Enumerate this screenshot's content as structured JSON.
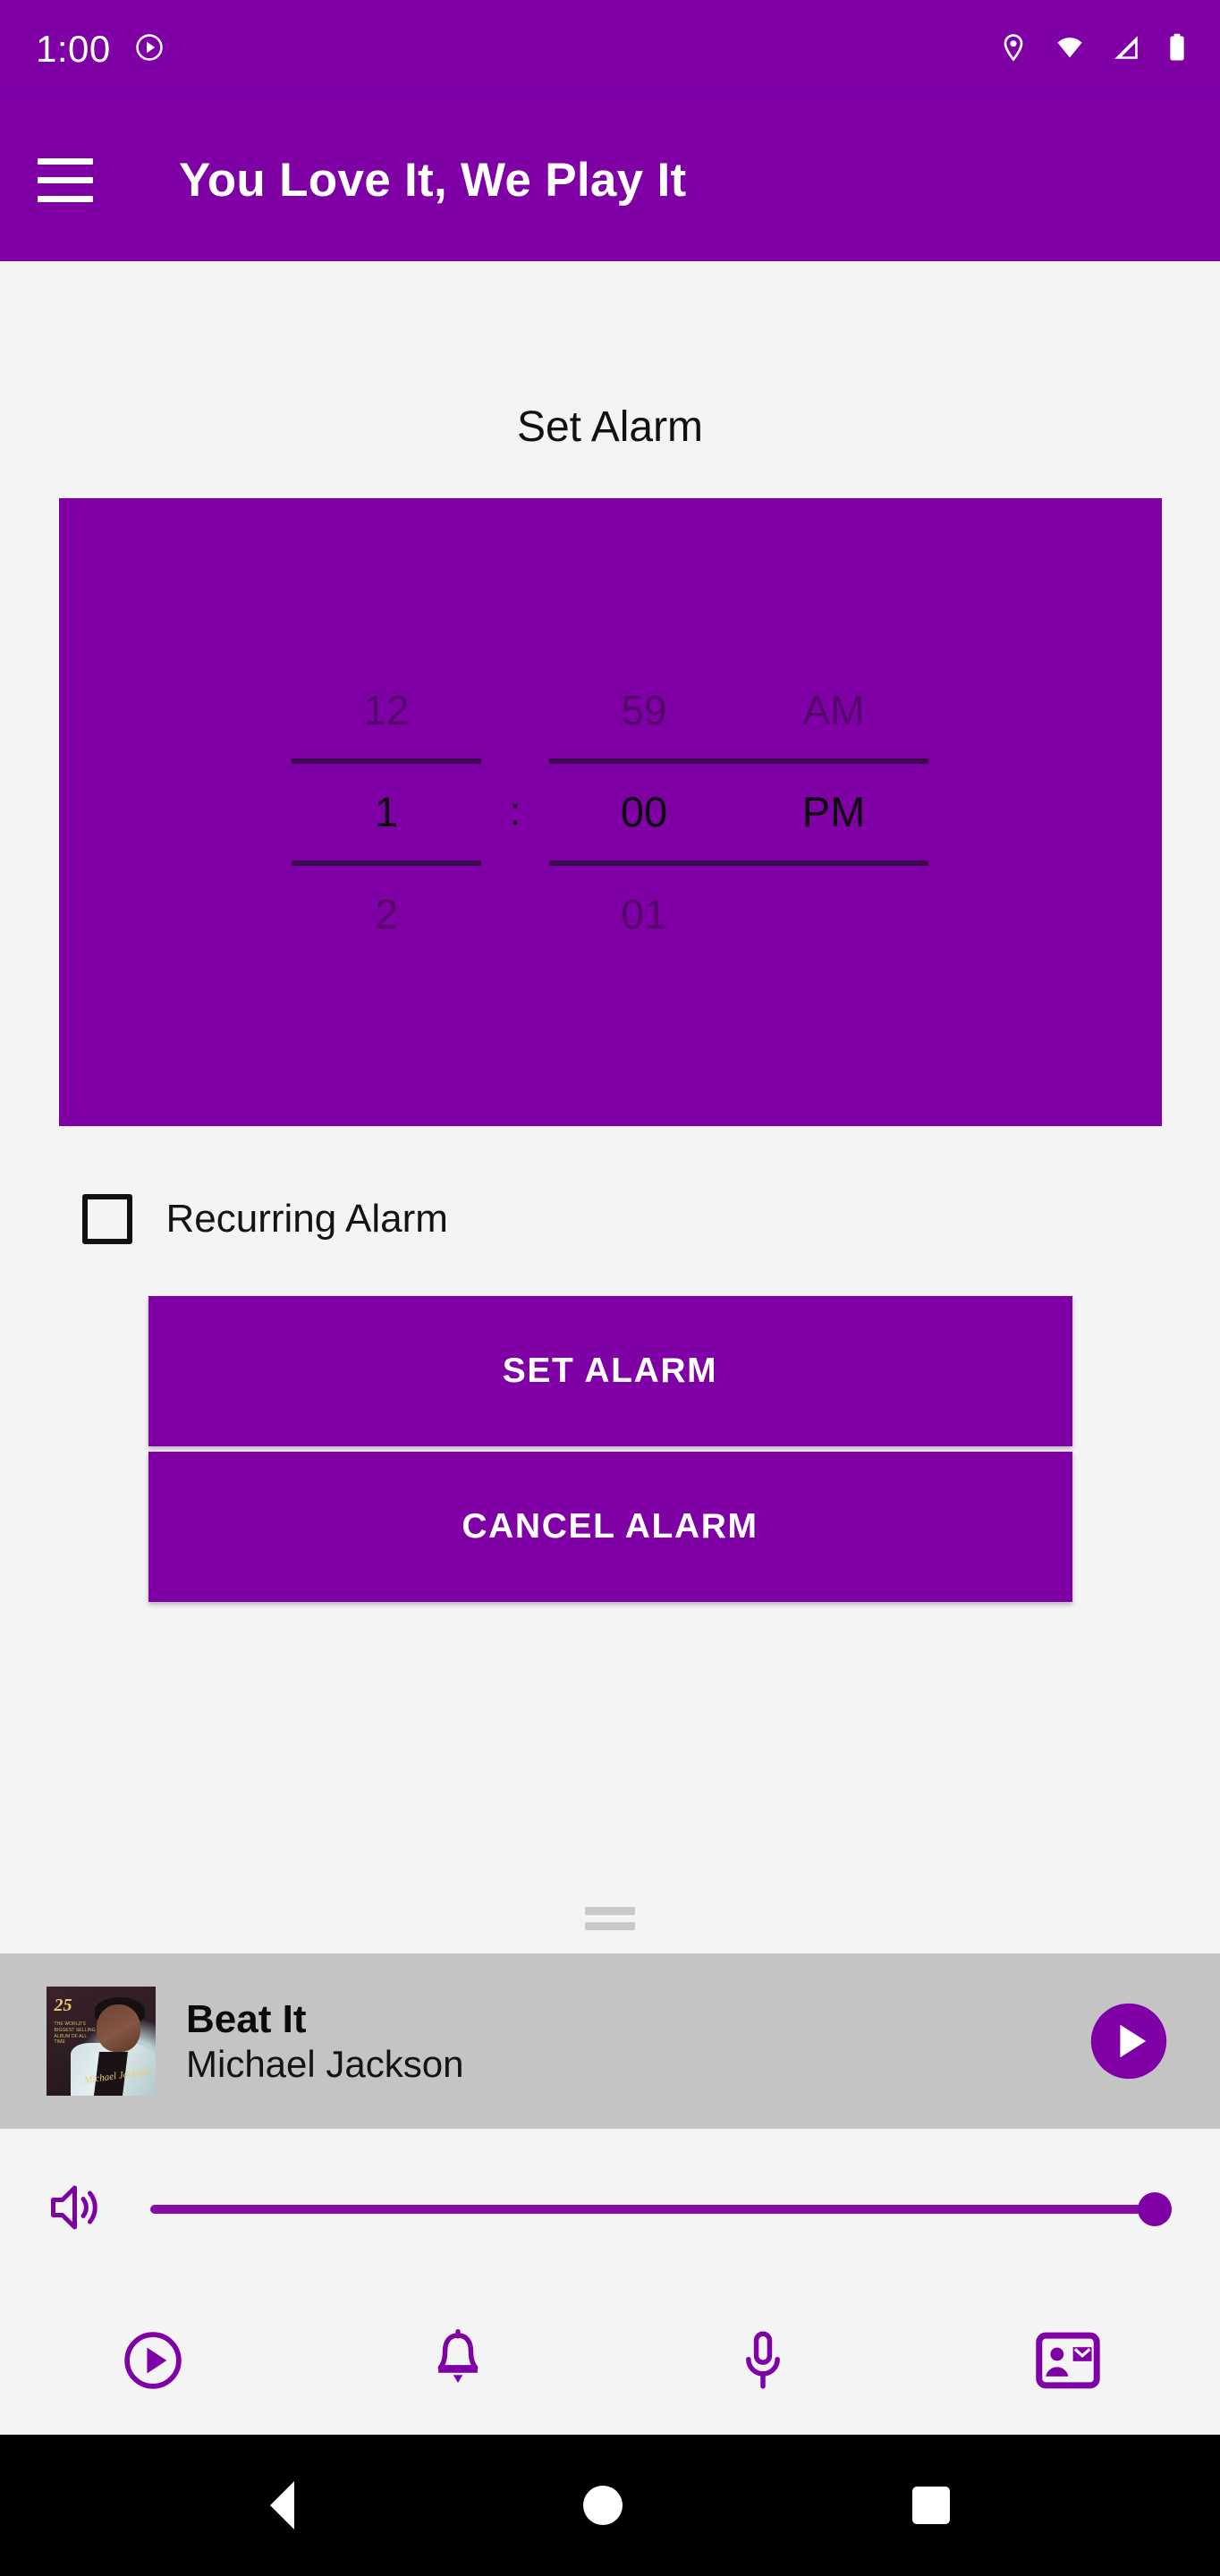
{
  "status_bar": {
    "clock": "1:00",
    "icons": [
      "play-circle-icon",
      "location-pin-icon",
      "wifi-icon",
      "cellular-signal-icon",
      "battery-icon"
    ]
  },
  "app_bar": {
    "menu_icon": "hamburger-menu-icon",
    "title": "You Love It, We Play It"
  },
  "main": {
    "section_title": "Set Alarm",
    "time_picker": {
      "hour": {
        "previous": "12",
        "selected": "1",
        "next": "2"
      },
      "minute": {
        "previous": "59",
        "selected": "00",
        "next": "01"
      },
      "period": {
        "previous": "AM",
        "selected": "PM",
        "next": ""
      },
      "separator": ":",
      "background_color": "#7F00A5",
      "selected_time": "1:00 PM"
    },
    "recurring": {
      "label": "Recurring Alarm",
      "checked": false
    },
    "buttons": {
      "set_alarm": "SET ALARM",
      "cancel_alarm": "CANCEL ALARM"
    },
    "drag_handle": "bottom-sheet-drag-handle"
  },
  "media_bar": {
    "album_art": {
      "alt": "Thriller 25 album cover",
      "badge": "25",
      "tagline": "THE WORLD'S BIGGEST SELLING ALBUM OF ALL TIME",
      "signature": "Michael Jackson"
    },
    "title": "Beat It",
    "artist": "Michael Jackson",
    "play_button_icon": "play-circle-icon",
    "background_color": "#C4C4C4"
  },
  "volume": {
    "icon": "speaker-volume-icon",
    "value": 100,
    "accent_color": "#7F00A5"
  },
  "tab_bar": {
    "tabs": [
      {
        "name": "player",
        "icon": "play-circle-outline-icon"
      },
      {
        "name": "alarm",
        "icon": "bell-icon"
      },
      {
        "name": "voice",
        "icon": "microphone-icon"
      },
      {
        "name": "contacts",
        "icon": "contact-card-icon"
      }
    ],
    "accent_color": "#7F00A5"
  },
  "android_nav": {
    "buttons": [
      {
        "name": "back",
        "icon": "triangle-back-icon"
      },
      {
        "name": "home",
        "icon": "circle-home-icon"
      },
      {
        "name": "recents",
        "icon": "square-recents-icon"
      }
    ]
  }
}
